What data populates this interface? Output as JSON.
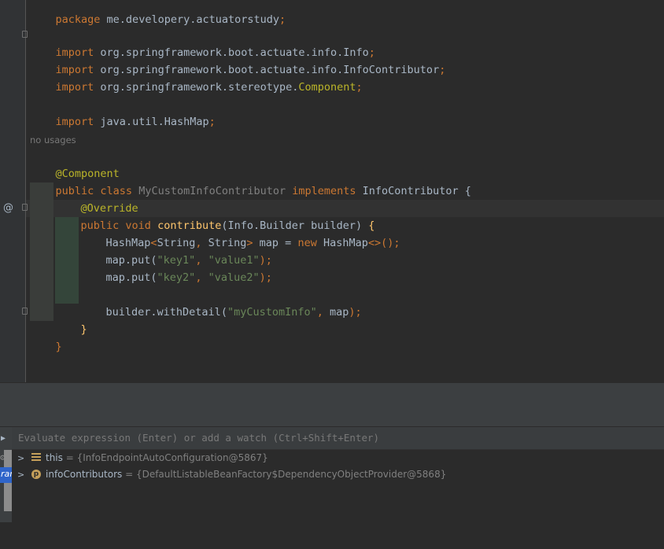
{
  "editor": {
    "lines": {
      "l1_kw": "package",
      "l1_rest": " me.developery.actuatorstudy",
      "l1_semi": ";",
      "l3_kw": "import",
      "l3_rest": " org.springframework.boot.actuate.info.Info",
      "l3_semi": ";",
      "l4_kw": "import",
      "l4_rest": " org.springframework.boot.actuate.info.InfoContributor",
      "l4_semi": ";",
      "l5_kw": "import",
      "l5_rest": " org.springframework.stereotype.",
      "l5_cls": "Component",
      "l5_semi": ";",
      "l7_kw": "import",
      "l7_rest": " java.util.HashMap",
      "l7_semi": ";",
      "no_usages": "no usages",
      "l9_ann": "@Component",
      "l10_kw": "public class ",
      "l10_cls": "MyCustomInfoContributor",
      "l10_impl": " implements ",
      "l10_iface": "InfoContributor",
      "l10_brace": " {",
      "l11_ann": "@Override",
      "l12_kw": "public void ",
      "l12_mth": "contribute",
      "l12_p1": "(Info.Builder builder",
      "l12_p2": ") ",
      "l12_brace": "{",
      "l13_a": "HashMap",
      "l13_b": "<",
      "l13_c": "String",
      "l13_d": ", ",
      "l13_e": "String",
      "l13_f": "> ",
      "l13_g": "map = ",
      "l13_h": "new ",
      "l13_i": "HashMap",
      "l13_j": "<>();",
      "l14_a": "map.put(",
      "l14_s1": "\"key1\"",
      "l14_c": ", ",
      "l14_s2": "\"value1\"",
      "l14_e": ");",
      "l15_a": "map.put(",
      "l15_s1": "\"key2\"",
      "l15_c": ", ",
      "l15_s2": "\"value2\"",
      "l15_e": ");",
      "l17_a": "builder.withDetail(",
      "l17_s1": "\"myCustomInfo\"",
      "l17_c": ", ",
      "l17_d": "map",
      "l17_e": ");",
      "l18_brace": "}",
      "l19_brace": "}"
    },
    "gutter_marker": "@"
  },
  "debugger": {
    "evaluate_placeholder": "Evaluate expression (Enter) or add a watch (Ctrl+Shift+Enter)",
    "frame_label": "ran",
    "variables": [
      {
        "name": "this",
        "eq": " = ",
        "value": "{InfoEndpointAutoConfiguration@5867}",
        "icon": "field-list-icon"
      },
      {
        "name": "infoContributors",
        "eq": " = ",
        "value": "{DefaultListableBeanFactory$DependencyObjectProvider@5868}",
        "icon": "parameter-icon",
        "icon_letter": "p"
      }
    ]
  },
  "colors": {
    "keyword": "#cc7832",
    "annotation": "#bbb529",
    "string": "#6a8759",
    "method": "#ffc66d",
    "identifier": "#a9b7c6",
    "background": "#2b2b2b"
  }
}
